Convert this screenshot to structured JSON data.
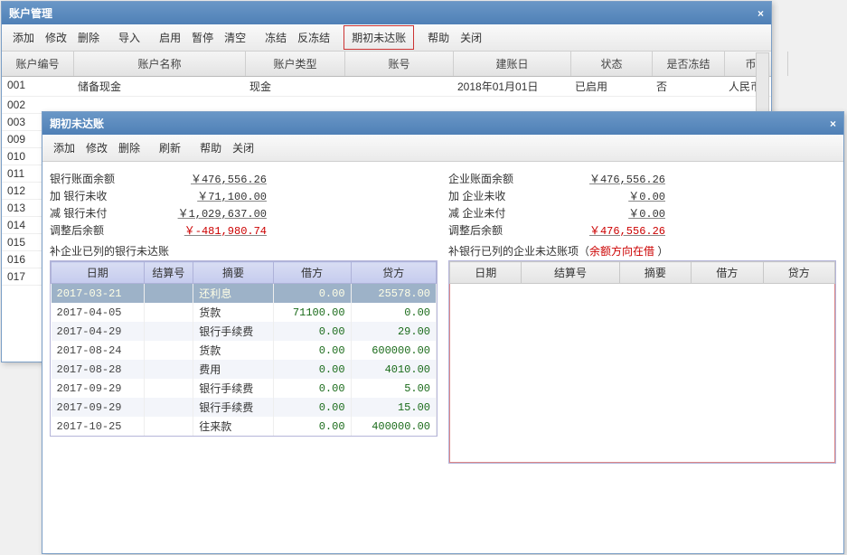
{
  "main_window": {
    "title": "账户管理",
    "close": "×",
    "toolbar_groups": [
      [
        "添加",
        "修改",
        "删除"
      ],
      [
        "导入"
      ],
      [
        "启用",
        "暂停",
        "清空"
      ],
      [
        "冻结",
        "反冻结"
      ],
      [
        "期初未达账"
      ],
      [
        "帮助",
        "关闭"
      ]
    ],
    "highlight_group_index": 4,
    "columns": [
      "账户编号",
      "账户名称",
      "账户类型",
      "账号",
      "建账日",
      "状态",
      "是否冻结",
      "币种"
    ],
    "rows": [
      {
        "id": "001",
        "name": "储备现金",
        "type": "现金",
        "no": "",
        "date": "2018年01月01日",
        "status": "已启用",
        "frozen": "否",
        "currency": "人民币"
      },
      {
        "id": "002"
      },
      {
        "id": "003"
      },
      {
        "id": "009"
      },
      {
        "id": "010"
      },
      {
        "id": "011"
      },
      {
        "id": "012"
      },
      {
        "id": "013"
      },
      {
        "id": "014"
      },
      {
        "id": "015"
      },
      {
        "id": "016"
      },
      {
        "id": "017"
      }
    ]
  },
  "dialog": {
    "title": "期初未达账",
    "close": "×",
    "toolbar_groups": [
      [
        "添加",
        "修改",
        "删除"
      ],
      [
        "刷新"
      ],
      [
        "帮助",
        "关闭"
      ]
    ],
    "left_summary": [
      {
        "label": "银行账面余额",
        "value": "￥476,556.26"
      },
      {
        "label": "加 银行未收",
        "value": "￥71,100.00"
      },
      {
        "label": "减 银行未付",
        "value": "￥1,029,637.00"
      },
      {
        "label": "调整后余额",
        "value": "￥-481,980.74",
        "neg": true
      }
    ],
    "right_summary": [
      {
        "label": "企业账面余额",
        "value": "￥476,556.26"
      },
      {
        "label": "加 企业未收",
        "value": "￥0.00"
      },
      {
        "label": "减 企业未付",
        "value": "￥0.00"
      },
      {
        "label": "调整后余额",
        "value": "￥476,556.26",
        "neg": true
      }
    ],
    "left_caption": "补企业已列的银行未达账",
    "right_caption_a": "补银行已列的企业未达账项（",
    "right_caption_b": "余额方向在借",
    "right_caption_c": "  ）",
    "columns": [
      "日期",
      "结算号",
      "摘要",
      "借方",
      "贷方"
    ],
    "left_rows": [
      {
        "date": "2017-03-21",
        "summary": "还利息",
        "debit": "0.00",
        "credit": "25578.00",
        "sel": true
      },
      {
        "date": "2017-04-05",
        "summary": "货款",
        "debit": "71100.00",
        "credit": "0.00"
      },
      {
        "date": "2017-04-29",
        "summary": "银行手续费",
        "debit": "0.00",
        "credit": "29.00"
      },
      {
        "date": "2017-08-24",
        "summary": "货款",
        "debit": "0.00",
        "credit": "600000.00"
      },
      {
        "date": "2017-08-28",
        "summary": "费用",
        "debit": "0.00",
        "credit": "4010.00"
      },
      {
        "date": "2017-09-29",
        "summary": "银行手续费",
        "debit": "0.00",
        "credit": "5.00"
      },
      {
        "date": "2017-09-29",
        "summary": "银行手续费",
        "debit": "0.00",
        "credit": "15.00"
      },
      {
        "date": "2017-10-25",
        "summary": "往来款",
        "debit": "0.00",
        "credit": "400000.00"
      }
    ]
  }
}
